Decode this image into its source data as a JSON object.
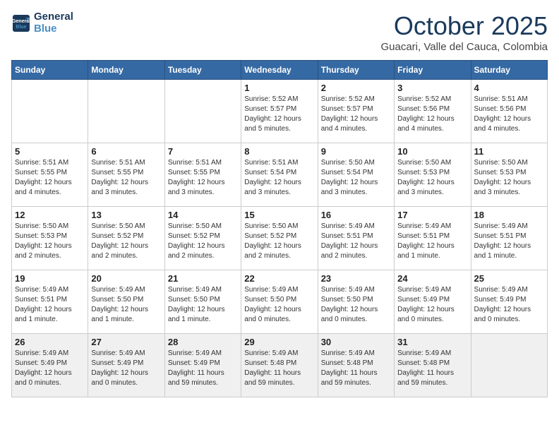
{
  "header": {
    "logo_line1": "General",
    "logo_line2": "Blue",
    "month": "October 2025",
    "location": "Guacari, Valle del Cauca, Colombia"
  },
  "days_of_week": [
    "Sunday",
    "Monday",
    "Tuesday",
    "Wednesday",
    "Thursday",
    "Friday",
    "Saturday"
  ],
  "weeks": [
    [
      {
        "day": "",
        "content": ""
      },
      {
        "day": "",
        "content": ""
      },
      {
        "day": "",
        "content": ""
      },
      {
        "day": "1",
        "content": "Sunrise: 5:52 AM\nSunset: 5:57 PM\nDaylight: 12 hours\nand 5 minutes."
      },
      {
        "day": "2",
        "content": "Sunrise: 5:52 AM\nSunset: 5:57 PM\nDaylight: 12 hours\nand 4 minutes."
      },
      {
        "day": "3",
        "content": "Sunrise: 5:52 AM\nSunset: 5:56 PM\nDaylight: 12 hours\nand 4 minutes."
      },
      {
        "day": "4",
        "content": "Sunrise: 5:51 AM\nSunset: 5:56 PM\nDaylight: 12 hours\nand 4 minutes."
      }
    ],
    [
      {
        "day": "5",
        "content": "Sunrise: 5:51 AM\nSunset: 5:55 PM\nDaylight: 12 hours\nand 4 minutes."
      },
      {
        "day": "6",
        "content": "Sunrise: 5:51 AM\nSunset: 5:55 PM\nDaylight: 12 hours\nand 3 minutes."
      },
      {
        "day": "7",
        "content": "Sunrise: 5:51 AM\nSunset: 5:55 PM\nDaylight: 12 hours\nand 3 minutes."
      },
      {
        "day": "8",
        "content": "Sunrise: 5:51 AM\nSunset: 5:54 PM\nDaylight: 12 hours\nand 3 minutes."
      },
      {
        "day": "9",
        "content": "Sunrise: 5:50 AM\nSunset: 5:54 PM\nDaylight: 12 hours\nand 3 minutes."
      },
      {
        "day": "10",
        "content": "Sunrise: 5:50 AM\nSunset: 5:53 PM\nDaylight: 12 hours\nand 3 minutes."
      },
      {
        "day": "11",
        "content": "Sunrise: 5:50 AM\nSunset: 5:53 PM\nDaylight: 12 hours\nand 3 minutes."
      }
    ],
    [
      {
        "day": "12",
        "content": "Sunrise: 5:50 AM\nSunset: 5:53 PM\nDaylight: 12 hours\nand 2 minutes."
      },
      {
        "day": "13",
        "content": "Sunrise: 5:50 AM\nSunset: 5:52 PM\nDaylight: 12 hours\nand 2 minutes."
      },
      {
        "day": "14",
        "content": "Sunrise: 5:50 AM\nSunset: 5:52 PM\nDaylight: 12 hours\nand 2 minutes."
      },
      {
        "day": "15",
        "content": "Sunrise: 5:50 AM\nSunset: 5:52 PM\nDaylight: 12 hours\nand 2 minutes."
      },
      {
        "day": "16",
        "content": "Sunrise: 5:49 AM\nSunset: 5:51 PM\nDaylight: 12 hours\nand 2 minutes."
      },
      {
        "day": "17",
        "content": "Sunrise: 5:49 AM\nSunset: 5:51 PM\nDaylight: 12 hours\nand 1 minute."
      },
      {
        "day": "18",
        "content": "Sunrise: 5:49 AM\nSunset: 5:51 PM\nDaylight: 12 hours\nand 1 minute."
      }
    ],
    [
      {
        "day": "19",
        "content": "Sunrise: 5:49 AM\nSunset: 5:51 PM\nDaylight: 12 hours\nand 1 minute."
      },
      {
        "day": "20",
        "content": "Sunrise: 5:49 AM\nSunset: 5:50 PM\nDaylight: 12 hours\nand 1 minute."
      },
      {
        "day": "21",
        "content": "Sunrise: 5:49 AM\nSunset: 5:50 PM\nDaylight: 12 hours\nand 1 minute."
      },
      {
        "day": "22",
        "content": "Sunrise: 5:49 AM\nSunset: 5:50 PM\nDaylight: 12 hours\nand 0 minutes."
      },
      {
        "day": "23",
        "content": "Sunrise: 5:49 AM\nSunset: 5:50 PM\nDaylight: 12 hours\nand 0 minutes."
      },
      {
        "day": "24",
        "content": "Sunrise: 5:49 AM\nSunset: 5:49 PM\nDaylight: 12 hours\nand 0 minutes."
      },
      {
        "day": "25",
        "content": "Sunrise: 5:49 AM\nSunset: 5:49 PM\nDaylight: 12 hours\nand 0 minutes."
      }
    ],
    [
      {
        "day": "26",
        "content": "Sunrise: 5:49 AM\nSunset: 5:49 PM\nDaylight: 12 hours\nand 0 minutes."
      },
      {
        "day": "27",
        "content": "Sunrise: 5:49 AM\nSunset: 5:49 PM\nDaylight: 12 hours\nand 0 minutes."
      },
      {
        "day": "28",
        "content": "Sunrise: 5:49 AM\nSunset: 5:49 PM\nDaylight: 11 hours\nand 59 minutes."
      },
      {
        "day": "29",
        "content": "Sunrise: 5:49 AM\nSunset: 5:48 PM\nDaylight: 11 hours\nand 59 minutes."
      },
      {
        "day": "30",
        "content": "Sunrise: 5:49 AM\nSunset: 5:48 PM\nDaylight: 11 hours\nand 59 minutes."
      },
      {
        "day": "31",
        "content": "Sunrise: 5:49 AM\nSunset: 5:48 PM\nDaylight: 11 hours\nand 59 minutes."
      },
      {
        "day": "",
        "content": ""
      }
    ]
  ]
}
